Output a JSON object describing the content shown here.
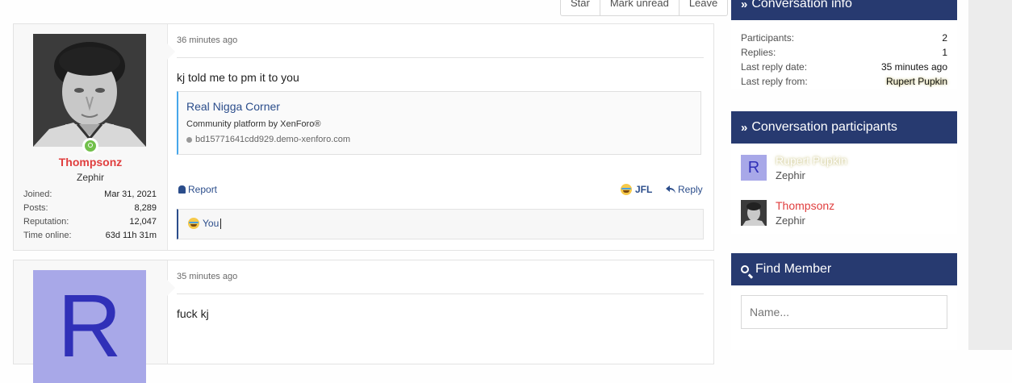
{
  "topbar": {
    "buttons": [
      "Star",
      "Mark unread",
      "Leave"
    ]
  },
  "messages": [
    {
      "user": {
        "name": "Thompsonz",
        "title": "Zephir",
        "stats": [
          {
            "label": "Joined:",
            "value": "Mar 31, 2021"
          },
          {
            "label": "Posts:",
            "value": "8,289"
          },
          {
            "label": "Reputation:",
            "value": "12,047"
          },
          {
            "label": "Time online:",
            "value": "63d 11h 31m"
          }
        ]
      },
      "date": "36 minutes ago",
      "text": "kj told me to pm it to you",
      "embed": {
        "title": "Real Nigga Corner",
        "description": "Community platform by XenForo®",
        "url": "bd15771641cdd929.demo-xenforo.com"
      },
      "actions": {
        "report": "Report",
        "reaction": "JFL",
        "reply": "Reply"
      },
      "reaction_summary": "You"
    },
    {
      "user": {
        "avatar_letter": "R"
      },
      "date": "35 minutes ago",
      "text": "fuck kj"
    }
  ],
  "sidebar": {
    "info": {
      "title": "Conversation info",
      "rows": [
        {
          "label": "Participants:",
          "value": "2"
        },
        {
          "label": "Replies:",
          "value": "1"
        },
        {
          "label": "Last reply date:",
          "value": "35 minutes ago"
        },
        {
          "label": "Last reply from:",
          "value": "Rupert Pupkin"
        }
      ]
    },
    "participants": {
      "title": "Conversation participants",
      "list": [
        {
          "avatar_letter": "R",
          "name": "Rupert Pupkin",
          "title": "Zephir"
        },
        {
          "name": "Thompsonz",
          "title": "Zephir"
        }
      ]
    },
    "find_member": {
      "title": "Find Member",
      "placeholder": "Name..."
    }
  },
  "colors": {
    "header_bg": "#273a70",
    "link": "#2b4d8b",
    "username_red": "#e03e3e",
    "online": "#72c04b",
    "avatar_letter_bg": "#a8a8e8"
  }
}
